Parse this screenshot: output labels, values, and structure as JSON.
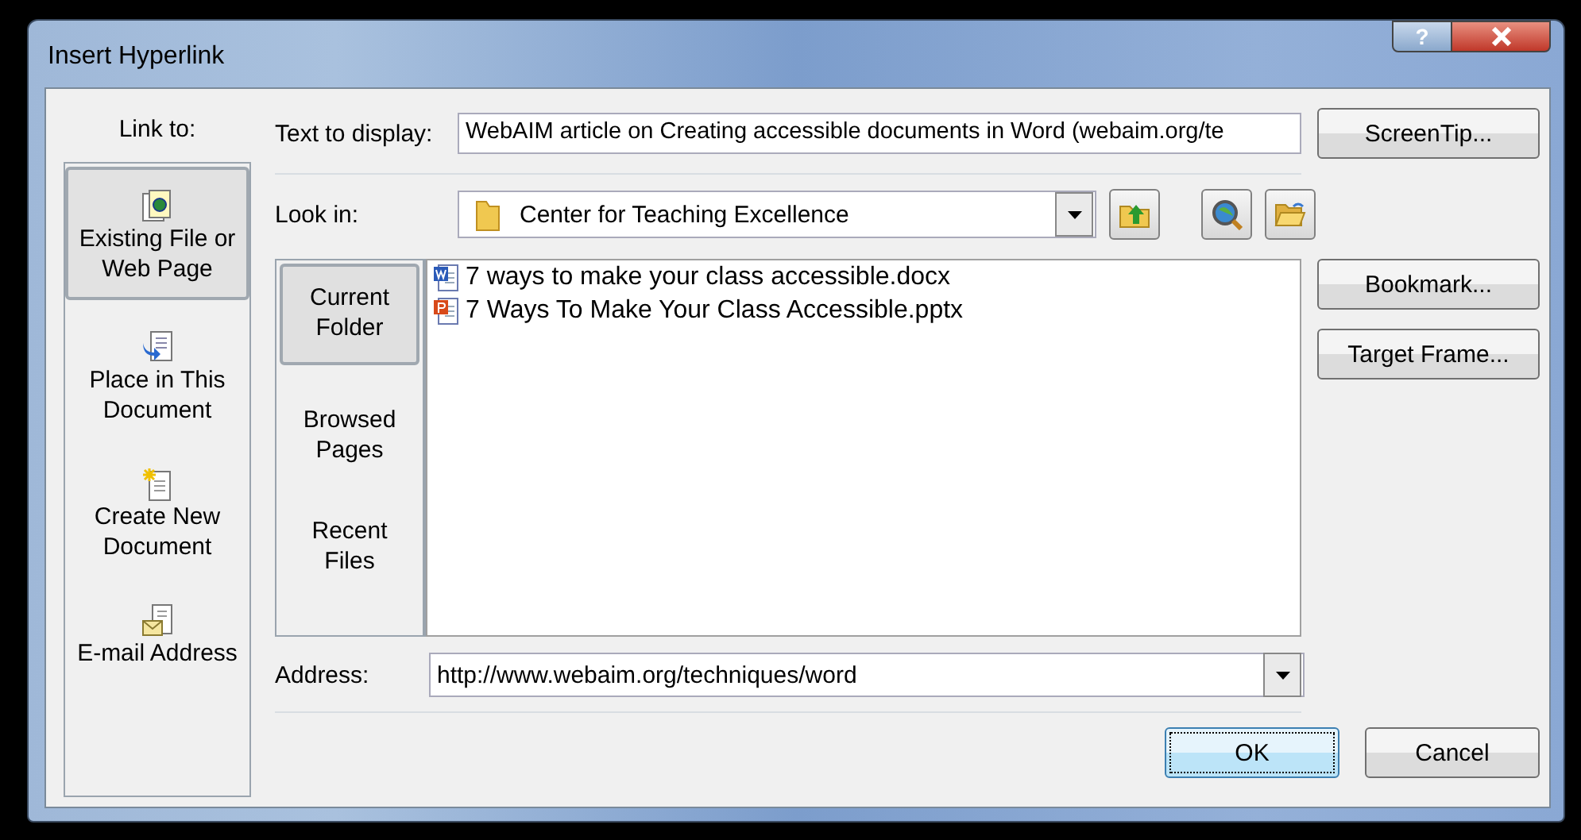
{
  "window": {
    "title": "Insert Hyperlink",
    "help_button": "?"
  },
  "link_to": {
    "label": "Link to:",
    "items": [
      {
        "kind": "file",
        "label": "Existing File or Web Page",
        "selected": true
      },
      {
        "kind": "place",
        "label": "Place in This Document",
        "selected": false
      },
      {
        "kind": "new",
        "label": "Create New Document",
        "selected": false
      },
      {
        "kind": "email",
        "label": "E-mail Address",
        "selected": false
      }
    ]
  },
  "text_to_display": {
    "label": "Text to display:",
    "value": "WebAIM article on Creating accessible documents in Word (webaim.org/te"
  },
  "look_in": {
    "label": "Look in:",
    "value": "Center for Teaching Excellence"
  },
  "browse_tabs": [
    {
      "label": "Current Folder",
      "selected": true
    },
    {
      "label": "Browsed Pages",
      "selected": false
    },
    {
      "label": "Recent Files",
      "selected": false
    }
  ],
  "files": [
    {
      "kind": "docx",
      "name": "7 ways to make your class accessible.docx"
    },
    {
      "kind": "pptx",
      "name": "7 Ways To Make Your Class Accessible.pptx"
    }
  ],
  "address": {
    "label": "Address:",
    "value": "http://www.webaim.org/techniques/word"
  },
  "side_buttons": [
    "ScreenTip...",
    "Bookmark...",
    "Target Frame..."
  ],
  "buttons": [
    {
      "label": "OK",
      "focused": true
    },
    {
      "label": "Cancel",
      "focused": false
    }
  ]
}
